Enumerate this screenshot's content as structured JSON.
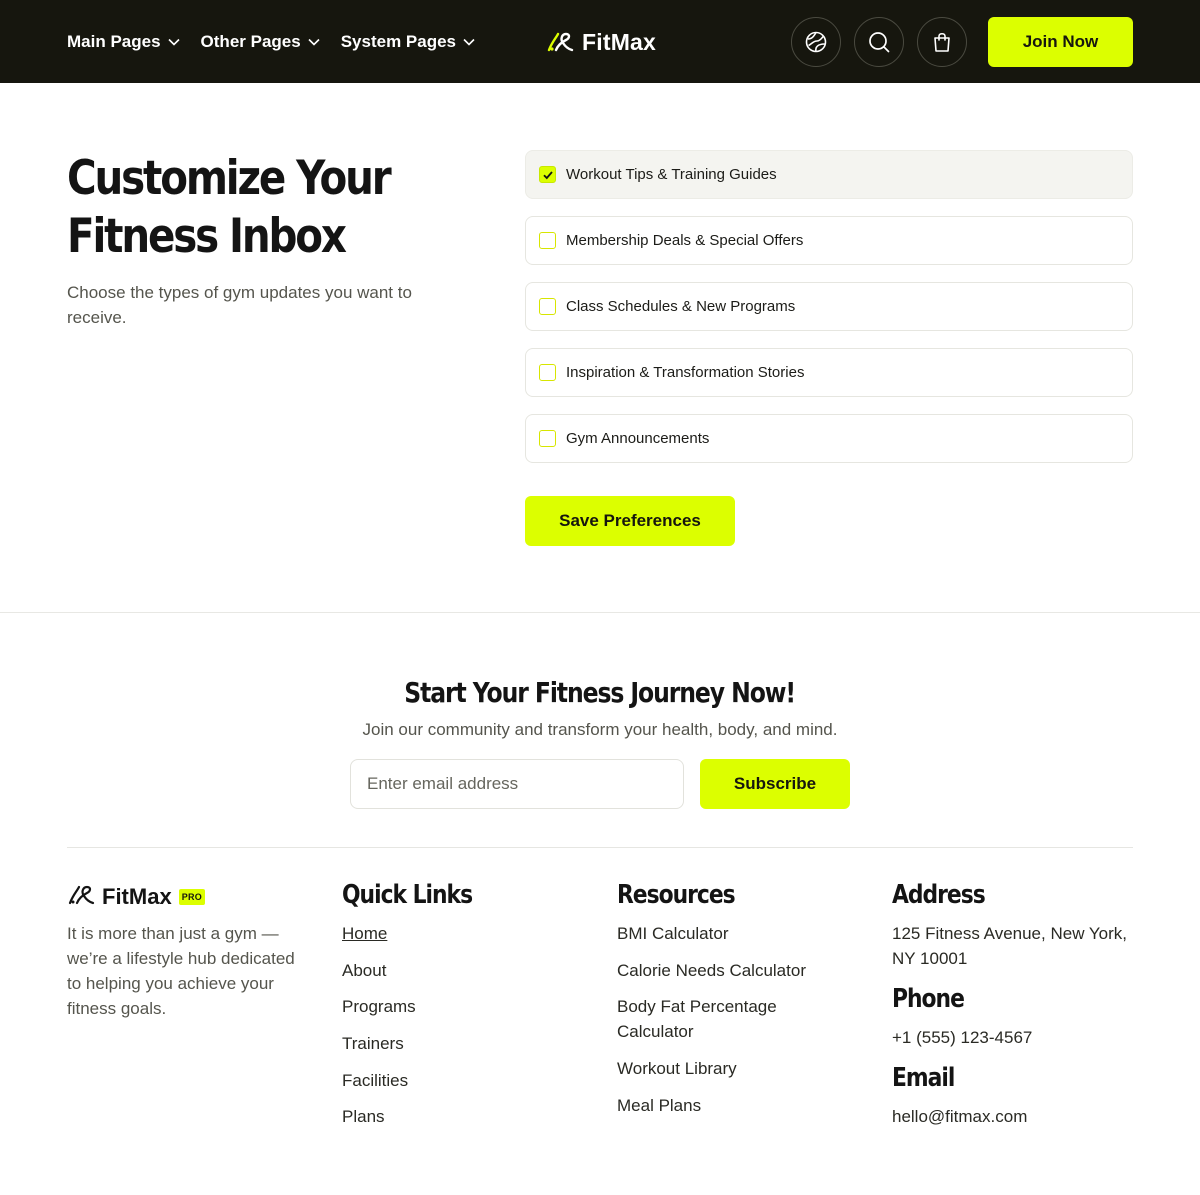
{
  "colors": {
    "accent": "#dcff00",
    "dark": "#16160e"
  },
  "header": {
    "nav": [
      {
        "label": "Main Pages"
      },
      {
        "label": "Other Pages"
      },
      {
        "label": "System Pages"
      }
    ],
    "logo_text": "FitMax",
    "icons": [
      "globe-icon",
      "search-icon",
      "shopping-bag-icon"
    ],
    "join_label": "Join Now"
  },
  "preferences": {
    "title_line1": "Customize Your",
    "title_line2": "Fitness Inbox",
    "description": "Choose the types of gym updates you want to receive.",
    "options": [
      {
        "label": "Workout Tips & Training Guides",
        "checked": true
      },
      {
        "label": "Membership Deals & Special Offers",
        "checked": false
      },
      {
        "label": "Class Schedules & New Programs",
        "checked": false
      },
      {
        "label": "Inspiration & Transformation Stories",
        "checked": false
      },
      {
        "label": "Gym Announcements",
        "checked": false
      }
    ],
    "save_label": "Save Preferences"
  },
  "newsletter": {
    "title": "Start Your Fitness Journey Now!",
    "description": "Join our community and transform your health, body, and mind.",
    "email_placeholder": "Enter email address",
    "subscribe_label": "Subscribe"
  },
  "footer": {
    "logo_text": "FitMax",
    "badge": "PRO",
    "about_line1": "It is more than just a gym —",
    "about_line2": "we’re a lifestyle hub dedicated",
    "about_line3": "to helping you achieve your",
    "about_line4": "fitness goals.",
    "quick_links_title": "Quick Links",
    "quick_links": [
      "Home",
      "About",
      "Programs",
      "Trainers",
      "Facilities",
      "Plans"
    ],
    "resources_title": "Resources",
    "resources": [
      "BMI Calculator",
      "Calorie Needs Calculator",
      "Body Fat Percentage",
      "Calculator",
      "Workout Library",
      "Meal Plans"
    ],
    "address_title": "Address",
    "address_line1": "125 Fitness Avenue, New York,",
    "address_line2": "NY 10001",
    "phone_title": "Phone",
    "phone": "+1 (555) 123-4567",
    "email_title": "Email",
    "email": "hello@fitmax.com"
  }
}
